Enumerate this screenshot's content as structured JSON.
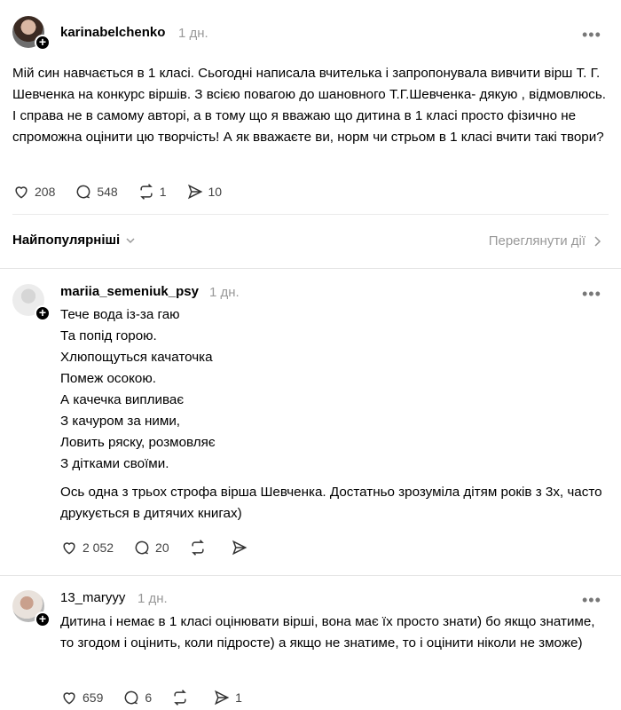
{
  "post": {
    "username": "karinabelchenko",
    "time": "1 дн.",
    "text": "Мій син навчається в 1 класі. Сьогодні написала вчителька і запропонувала вивчити вірш Т. Г. Шевченка на конкурс віршів. З всією повагою до шановного Т.Г.Шевченка- дякую , відмовлюсь. І справа не в самому авторі, а в тому що я вважаю що дитина в 1 класі просто фізично не спроможна оцінити цю творчість! А як вважаєте ви, норм чи стрьом в 1 класі вчити такі твори?",
    "likes": "208",
    "replies": "548",
    "reposts": "1",
    "shares": "10"
  },
  "sort": {
    "label": "Найпопулярніші",
    "view_activity": "Переглянути дії"
  },
  "comments": [
    {
      "username": "mariia_semeniuk_psy",
      "time": "1 дн.",
      "poem": [
        "Тече вода із-за гаю",
        "Та попід горою.",
        "Хлюпощуться качаточка",
        "Помеж осокою.",
        "А качечка випливає",
        "З качуром за ними,",
        "Ловить ряску, розмовляє",
        "З дітками своїми."
      ],
      "text": "Ось одна з трьох строфа вірша Шевченка. Достатньо зрозуміла дітям років з 3х, часто друкується в дитячих книгах)",
      "likes": "2 052",
      "replies": "20"
    },
    {
      "username": "13_maryyy",
      "time": "1 дн.",
      "text": "Дитина і немає в 1 класі оцінювати вірші, вона має їх просто знати) бо якщо знатиме, то згодом і оцінить, коли підросте) а якщо не знатиме, то і оцінити ніколи не зможе)",
      "likes": "659",
      "replies": "6",
      "shares": "1"
    }
  ],
  "icons": {
    "like": "heart-icon",
    "reply": "speech-bubble-icon",
    "repost": "repost-icon",
    "share": "send-icon",
    "more": "more-icon",
    "chevron_down": "chevron-down-icon",
    "chevron_right": "chevron-right-icon"
  }
}
